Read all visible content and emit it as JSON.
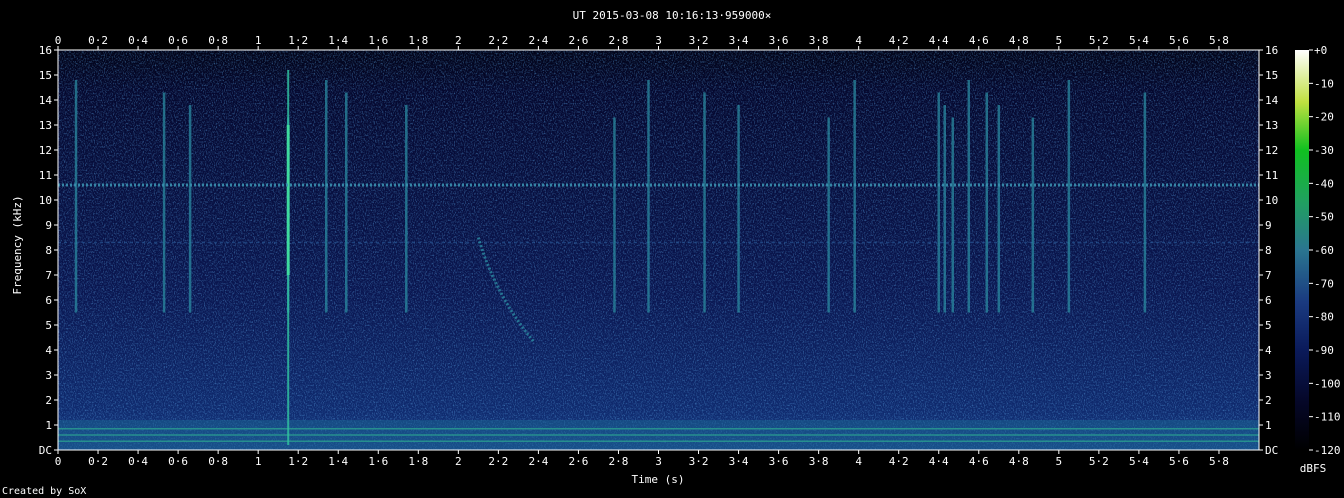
{
  "chart_data": {
    "type": "heatmap",
    "title": "UT 2015-03-08 10:16:13·959000×",
    "xlabel": "Time (s)",
    "ylabel": "Frequency (kHz)",
    "footer": "Created by SoX",
    "colorbar_label": "dBFS",
    "x_range": [
      0,
      6
    ],
    "y_range": [
      0,
      16
    ],
    "x_ticks": [
      "0",
      "0·2",
      "0·4",
      "0·6",
      "0·8",
      "1",
      "1·2",
      "1·4",
      "1·6",
      "1·8",
      "2",
      "2·2",
      "2·4",
      "2·6",
      "2·8",
      "3",
      "3·2",
      "3·4",
      "3·6",
      "3·8",
      "4",
      "4·2",
      "4·4",
      "4·6",
      "4·8",
      "5",
      "5·2",
      "5·4",
      "5·6",
      "5·8"
    ],
    "y_ticks": [
      "DC",
      "1",
      "2",
      "3",
      "4",
      "5",
      "6",
      "7",
      "8",
      "9",
      "10",
      "11",
      "12",
      "13",
      "14",
      "15",
      "16"
    ],
    "colorbar_range": [
      -120,
      0
    ],
    "colorbar_ticks": [
      "+0",
      "-10",
      "-20",
      "-30",
      "-40",
      "-50",
      "-60",
      "-70",
      "-80",
      "-90",
      "-100",
      "-110",
      "-120"
    ],
    "features": {
      "horizontal_line_khz": 10.6,
      "faint_line_khz": 8.3,
      "low_band_khz": [
        0,
        1.2
      ],
      "vertical_bursts_s": [
        0.09,
        0.53,
        0.66,
        1.15,
        1.34,
        1.44,
        1.74,
        2.78,
        2.95,
        3.23,
        3.4,
        3.85,
        3.98,
        4.4,
        4.43,
        4.47,
        4.55,
        4.64,
        4.7,
        4.87,
        5.05,
        5.43
      ],
      "strong_burst_s": 1.15,
      "chirp_s": [
        2.1,
        2.38
      ],
      "chirp_khz": [
        8.5,
        4.3
      ]
    }
  }
}
